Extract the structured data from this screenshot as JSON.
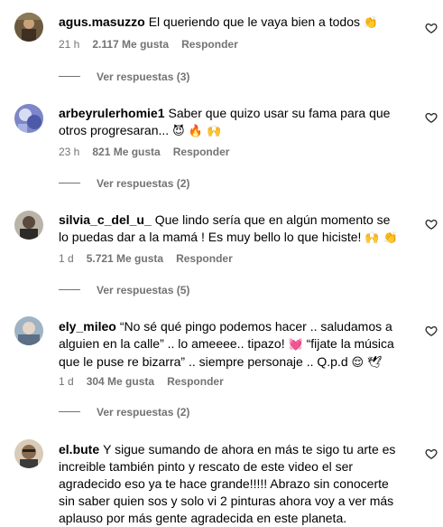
{
  "comments": [
    {
      "username": "agus.masuzzo",
      "text": "El queriendo que le vaya bien a todos",
      "emoji": "👏",
      "time": "21 h",
      "likes": "2.117 Me gusta",
      "reply_label": "Responder",
      "view_replies": "Ver respuestas (3)"
    },
    {
      "username": "arbeyrulerhomie1",
      "text": "Saber que quizo usar su fama para que otros progresaran...",
      "emoji": "😈 🔥 🙌",
      "time": "23 h",
      "likes": "821 Me gusta",
      "reply_label": "Responder",
      "view_replies": "Ver respuestas (2)"
    },
    {
      "username": "silvia_c_del_u_",
      "text": "Que lindo sería que en algún momento se lo puedas dar a la mamá ! Es muy bello lo que hiciste!",
      "emoji": "🙌 👏",
      "time": "1 d",
      "likes": "5.721 Me gusta",
      "reply_label": "Responder",
      "view_replies": "Ver respuestas (5)"
    },
    {
      "username": "ely_mileo",
      "text": "“No sé qué pingo podemos hacer .. saludamos a alguien en la calle” .. lo ameeee.. tipazo!",
      "emoji": "💓",
      "text2": "“fijate la música que le puse re bizarra” .. siempre personaje .. Q.p.d",
      "emoji2": "😌 🕊",
      "time": "1 d",
      "likes": "304 Me gusta",
      "reply_label": "Responder",
      "view_replies": "Ver respuestas (2)"
    },
    {
      "username": "el.bute",
      "text": "Y sigue sumando de ahora en más te sigo tu arte es increible también pinto y rescato de este video el ser agradecido eso ya te hace grande!!!!! Abrazo sin conocerte sin saber quien sos y solo vi 2 pinturas ahora voy a ver más aplauso por más gente agradecida en este planeta."
    }
  ],
  "icons": {
    "like": "heart-outline-icon"
  },
  "colors": {
    "text": "#000000",
    "secondary": "#737373",
    "background": "#ffffff"
  }
}
